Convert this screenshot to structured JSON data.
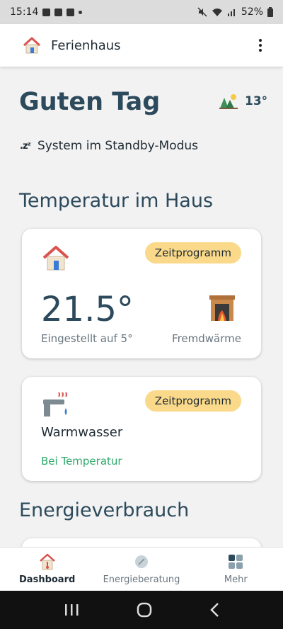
{
  "status_bar": {
    "time": "15:14",
    "battery": "52%"
  },
  "app_bar": {
    "title": "Ferienhaus"
  },
  "greeting": "Guten Tag",
  "weather": {
    "temperature": "13°"
  },
  "system_status": "System im Standby-Modus",
  "sections": {
    "temperature": "Temperatur im Haus",
    "energy": "Energieverbrauch"
  },
  "heating_card": {
    "badge": "Zeitprogramm",
    "temperature": "21.5°",
    "setpoint": "Eingestellt auf 5°",
    "heat_source": "Fremdwärme"
  },
  "water_card": {
    "badge": "Zeitprogramm",
    "label": "Warmwasser",
    "status": "Bei Temperatur"
  },
  "nav": {
    "dashboard": "Dashboard",
    "energy": "Energieberatung",
    "more": "Mehr"
  },
  "colors": {
    "primary": "#2c4a5c",
    "badge": "#fad98a",
    "status_green": "#2eaa6a",
    "background": "#f2f2f2"
  }
}
